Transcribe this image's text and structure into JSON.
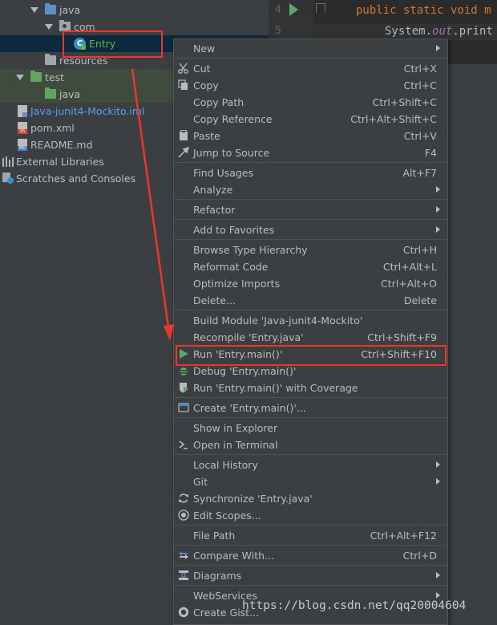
{
  "tree": {
    "items": [
      {
        "label": "java"
      },
      {
        "label": "com"
      },
      {
        "label": "Entry"
      },
      {
        "label": "resources"
      },
      {
        "label": "test"
      },
      {
        "label": "java"
      },
      {
        "label": "Java-junit4-Mockito.iml"
      },
      {
        "label": "pom.xml"
      },
      {
        "label": "README.md"
      },
      {
        "label": "External Libraries"
      },
      {
        "label": "Scratches and Consoles"
      }
    ]
  },
  "editor": {
    "line4": "4",
    "line5": "5",
    "line4_kw": "public static void ",
    "line4_rest": "m",
    "line5_a": "System.",
    "line5_b": "out",
    "line5_c": ".print"
  },
  "menu": {
    "items": [
      {
        "label": "New",
        "shortcut": ""
      },
      {
        "label": "Cut",
        "shortcut": "Ctrl+X"
      },
      {
        "label": "Copy",
        "shortcut": "Ctrl+C"
      },
      {
        "label": "Copy Path",
        "shortcut": "Ctrl+Shift+C"
      },
      {
        "label": "Copy Reference",
        "shortcut": "Ctrl+Alt+Shift+C"
      },
      {
        "label": "Paste",
        "shortcut": "Ctrl+V"
      },
      {
        "label": "Jump to Source",
        "shortcut": "F4"
      },
      {
        "label": "Find Usages",
        "shortcut": "Alt+F7"
      },
      {
        "label": "Analyze",
        "shortcut": ""
      },
      {
        "label": "Refactor",
        "shortcut": ""
      },
      {
        "label": "Add to Favorites",
        "shortcut": ""
      },
      {
        "label": "Browse Type Hierarchy",
        "shortcut": "Ctrl+H"
      },
      {
        "label": "Reformat Code",
        "shortcut": "Ctrl+Alt+L"
      },
      {
        "label": "Optimize Imports",
        "shortcut": "Ctrl+Alt+O"
      },
      {
        "label": "Delete...",
        "shortcut": "Delete"
      },
      {
        "label": "Build Module 'Java-junit4-Mockito'",
        "shortcut": ""
      },
      {
        "label": "Recompile 'Entry.java'",
        "shortcut": "Ctrl+Shift+F9"
      },
      {
        "label": "Run 'Entry.main()'",
        "shortcut": "Ctrl+Shift+F10"
      },
      {
        "label": "Debug 'Entry.main()'",
        "shortcut": ""
      },
      {
        "label": "Run 'Entry.main()' with Coverage",
        "shortcut": ""
      },
      {
        "label": "Create 'Entry.main()'...",
        "shortcut": ""
      },
      {
        "label": "Show in Explorer",
        "shortcut": ""
      },
      {
        "label": "Open in Terminal",
        "shortcut": ""
      },
      {
        "label": "Local History",
        "shortcut": ""
      },
      {
        "label": "Git",
        "shortcut": ""
      },
      {
        "label": "Synchronize 'Entry.java'",
        "shortcut": ""
      },
      {
        "label": "Edit Scopes...",
        "shortcut": ""
      },
      {
        "label": "File Path",
        "shortcut": "Ctrl+Alt+F12"
      },
      {
        "label": "Compare With...",
        "shortcut": "Ctrl+D"
      },
      {
        "label": "Diagrams",
        "shortcut": ""
      },
      {
        "label": "WebServices",
        "shortcut": ""
      },
      {
        "label": "Create Gist...",
        "shortcut": ""
      }
    ]
  },
  "watermark": "https://blog.csdn.net/qq20004604",
  "icons": {
    "cut": "scissors-icon",
    "copy": "copy-icon",
    "paste": "paste-icon",
    "jump": "jump-to-source-icon",
    "run": "run-icon",
    "debug": "debug-icon",
    "coverage": "coverage-icon",
    "create": "create-config-icon",
    "terminal": "terminal-icon",
    "edit_scopes": "edit-scopes-icon",
    "compare": "compare-icon",
    "diagrams": "diagrams-icon",
    "gist": "github-icon"
  },
  "colors": {
    "highlight_red": "#e8372f",
    "run_green": "#59a869",
    "menu_bg": "#3c3f41",
    "selected_row": "#0d293e"
  }
}
